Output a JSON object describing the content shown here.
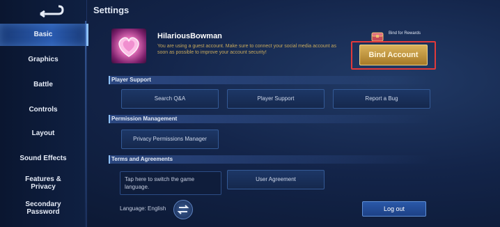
{
  "header": {
    "title": "Settings"
  },
  "sidebar": {
    "items": [
      {
        "label": "Basic",
        "active": true
      },
      {
        "label": "Graphics"
      },
      {
        "label": "Battle"
      },
      {
        "label": "Controls"
      },
      {
        "label": "Layout"
      },
      {
        "label": "Sound Effects"
      },
      {
        "label": "Features & Privacy"
      },
      {
        "label": "Secondary Password"
      }
    ]
  },
  "profile": {
    "username": "HilariousBowman",
    "guest_note": "You are using a guest account. Make sure to connect your social media account as soon as possible to improve your account security!",
    "bind_rewards_text": "Bind for Rewards",
    "bind_button": "Bind Account"
  },
  "sections": {
    "player_support": {
      "title": "Player Support",
      "buttons": [
        "Search Q&A",
        "Player Support",
        "Report a Bug"
      ]
    },
    "permission": {
      "title": "Permission Management",
      "buttons": [
        "Privacy Permissions Manager"
      ]
    },
    "terms": {
      "title": "Terms and Agreements",
      "language_box": "Tap here to switch the game language.",
      "buttons": [
        "User Agreement"
      ]
    }
  },
  "footer": {
    "language_label": "Language: English",
    "logout": "Log out"
  },
  "colors": {
    "accent_gold": "#d9b25a",
    "highlight_red": "#e23a3a",
    "primary_blue": "#2a58a8"
  }
}
